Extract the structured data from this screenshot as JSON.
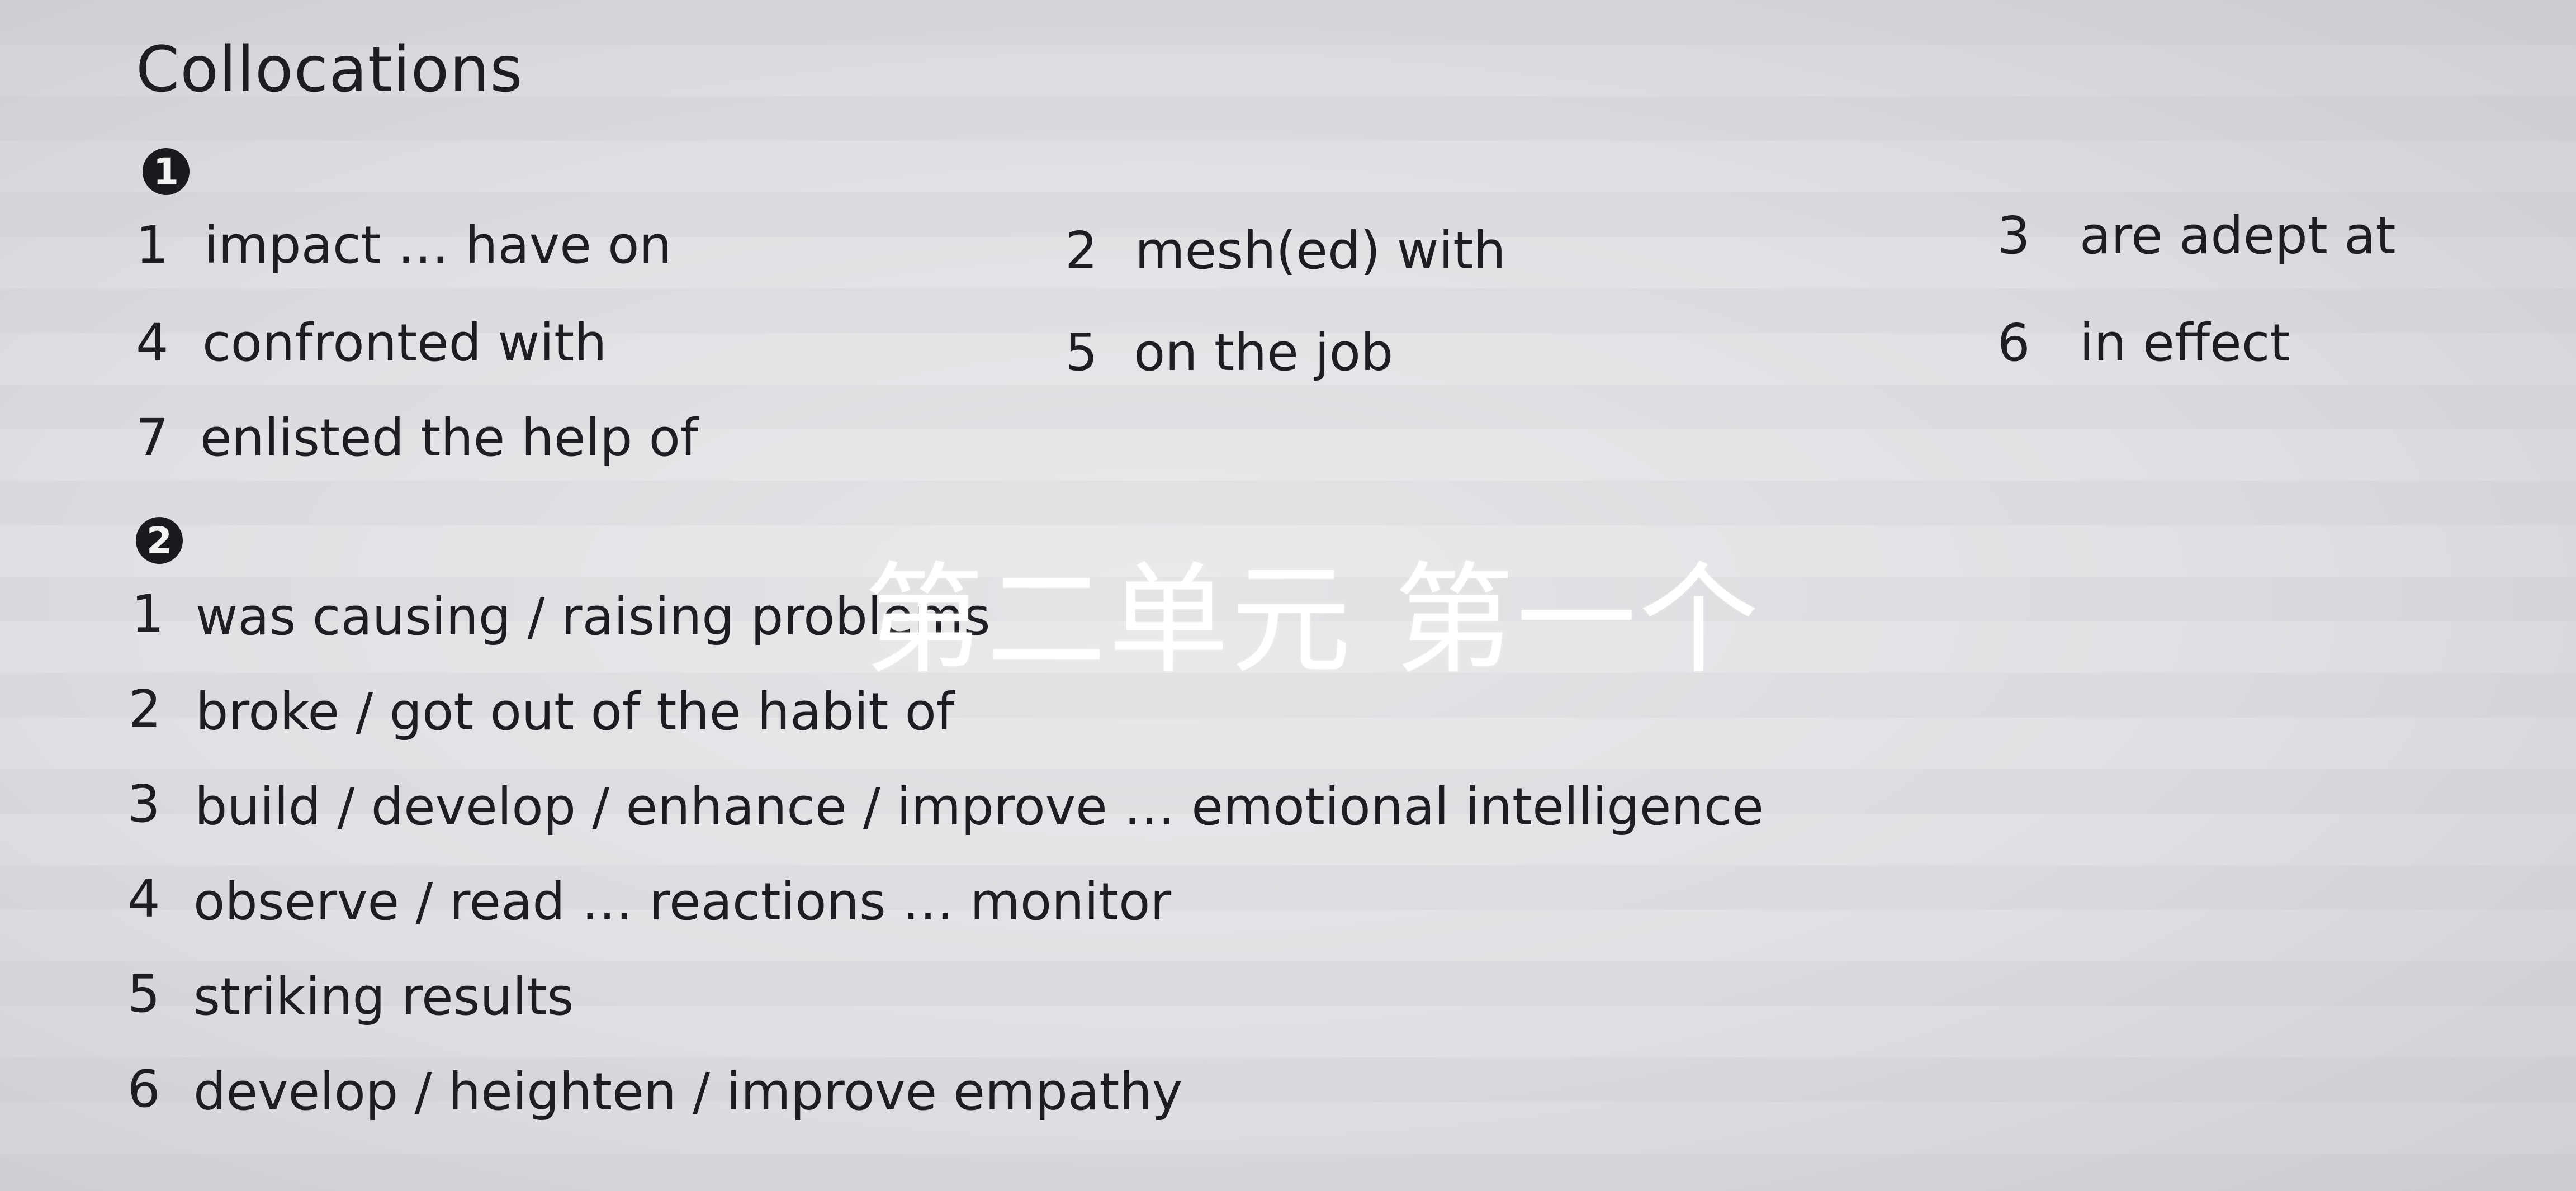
{
  "heading": "Collocations",
  "section1": {
    "marker": "1",
    "items": [
      {
        "num": "1",
        "text": "impact … have on"
      },
      {
        "num": "2",
        "text": "mesh(ed) with"
      },
      {
        "num": "3",
        "text": "are adept at"
      },
      {
        "num": "4",
        "text": "confronted with"
      },
      {
        "num": "5",
        "text": "on the job"
      },
      {
        "num": "6",
        "text": "in effect"
      },
      {
        "num": "7",
        "text": "enlisted the help of"
      }
    ]
  },
  "section2": {
    "marker": "2",
    "items": [
      {
        "num": "1",
        "text": "was causing / raising problems"
      },
      {
        "num": "2",
        "text": "broke / got out of the habit of"
      },
      {
        "num": "3",
        "text": "build / develop / enhance / improve … emotional intelligence"
      },
      {
        "num": "4",
        "text": "observe / read … reactions … monitor"
      },
      {
        "num": "5",
        "text": "striking results"
      },
      {
        "num": "6",
        "text": "develop / heighten / improve empathy"
      }
    ]
  },
  "overlay_caption": "第二单元 第一个"
}
